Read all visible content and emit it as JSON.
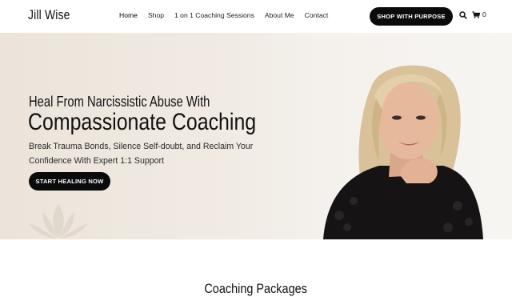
{
  "header": {
    "logo": "Jill Wise",
    "menu": [
      {
        "label": "Home"
      },
      {
        "label": "Shop"
      },
      {
        "label": "1 on 1 Coaching Sessions"
      },
      {
        "label": "About Me"
      },
      {
        "label": "Contact"
      }
    ],
    "shop_button": "SHOP WITH PURPOSE",
    "cart_count": "0",
    "icons": [
      "search-icon",
      "cart-icon"
    ]
  },
  "hero": {
    "heading_small": "Heal From Narcissistic Abuse With",
    "heading_large": "Compassionate Coaching",
    "subtext": "Break Trauma Bonds, Silence Self-doubt, and Reclaim Your Confidence With Expert 1:1 Support",
    "cta": "START HEALING NOW",
    "decor_icon": "lotus-icon"
  },
  "packages": {
    "title": "Coaching Packages"
  },
  "colors": {
    "button_bg": "#0b0b0b",
    "hero_bg": "#efe8e0",
    "text": "#111111"
  }
}
